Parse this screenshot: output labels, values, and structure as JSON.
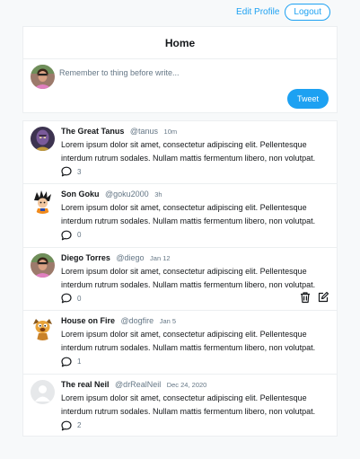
{
  "header": {
    "edit_profile": "Edit Profile",
    "logout": "Logout"
  },
  "home": {
    "title": "Home",
    "compose_placeholder": "Remember to thing before write...",
    "tweet_button": "Tweet"
  },
  "tweets": [
    {
      "author": "The Great Tanus",
      "handle": "@tanus",
      "time": "10m",
      "text": "Lorem ipsum dolor sit amet, consectetur adipiscing elit. Pellentesque interdum rutrum sodales. Nullam mattis fermentum libero, non volutpat.",
      "replies": "3",
      "avatar_icon": "purple-villain-avatar"
    },
    {
      "author": "Son Goku",
      "handle": "@goku2000",
      "time": "3h",
      "text": "Lorem ipsum dolor sit amet, consectetur adipiscing elit. Pellentesque interdum rutrum sodales. Nullam mattis fermentum libero, non volutpat.",
      "replies": "0",
      "avatar_icon": "spiky-hair-avatar"
    },
    {
      "author": "Diego Torres",
      "handle": "@diego",
      "time": "Jan 12",
      "text": "Lorem ipsum dolor sit amet, consectetur adipiscing elit. Pellentesque interdum rutrum sodales. Nullam mattis fermentum libero, non volutpat.",
      "replies": "0",
      "avatar_icon": "user-photo-avatar",
      "own": true
    },
    {
      "author": "House on Fire",
      "handle": "@dogfire",
      "time": "Jan 5",
      "text": "Lorem ipsum dolor sit amet, consectetur adipiscing elit. Pellentesque interdum rutrum sodales. Nullam mattis fermentum libero, non volutpat.",
      "replies": "1",
      "avatar_icon": "dog-avatar"
    },
    {
      "author": "The real Neil",
      "handle": "@drRealNeil",
      "time": "Dec 24, 2020",
      "text": "Lorem ipsum dolor sit amet, consectetur adipiscing elit. Pellentesque interdum rutrum sodales. Nullam mattis fermentum libero, non volutpat.",
      "replies": "2",
      "avatar_icon": "default-avatar"
    }
  ],
  "icons": {
    "reply": "speech-bubble-icon",
    "delete": "trash-icon",
    "edit": "edit-icon"
  },
  "colors": {
    "accent": "#1da1f2",
    "text": "#14171a",
    "muted": "#657786",
    "border": "#eceff1",
    "background": "#f7f9fa"
  }
}
